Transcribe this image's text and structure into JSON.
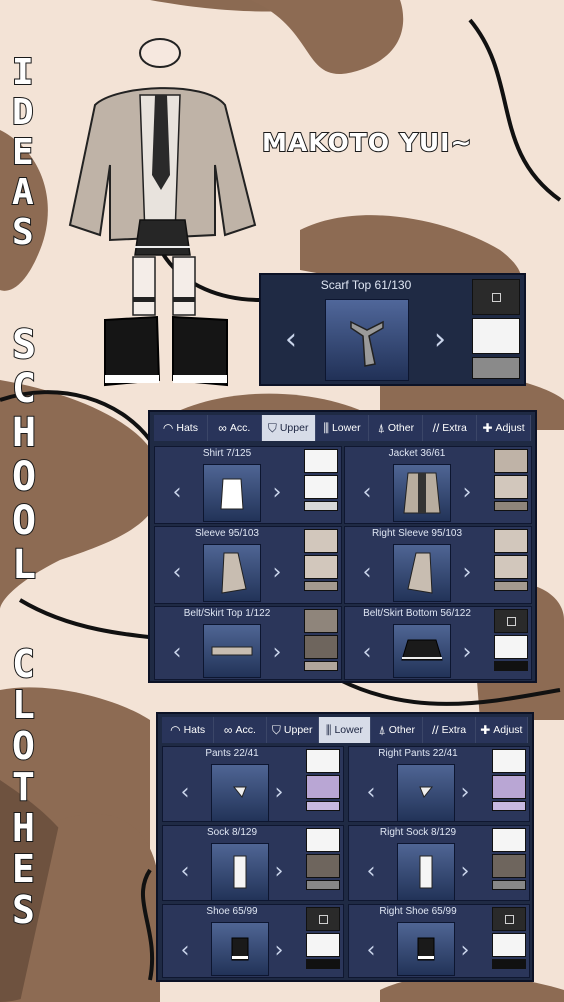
{
  "vertical_text": {
    "ideas": [
      "I",
      "D",
      "E",
      "A",
      "S"
    ],
    "school": [
      "S",
      "C",
      "H",
      "O",
      "O",
      "L"
    ],
    "clothes": [
      "C",
      "L",
      "O",
      "T",
      "H",
      "E",
      "S"
    ]
  },
  "name": "MAKOTO YUI~",
  "scarf": {
    "title": "Scarf Top 61/130"
  },
  "tabs": [
    {
      "icon": "cap-icon",
      "glyph": "◠",
      "label": "Hats"
    },
    {
      "icon": "glasses-icon",
      "glyph": "∞",
      "label": "Acc."
    },
    {
      "icon": "shirt-icon",
      "glyph": "⛉",
      "label": "Upper"
    },
    {
      "icon": "pants-icon",
      "glyph": "⫼",
      "label": "Lower"
    },
    {
      "icon": "bell-icon",
      "glyph": "⍋",
      "label": "Other"
    },
    {
      "icon": "slashes-icon",
      "glyph": "//",
      "label": "Extra"
    },
    {
      "icon": "move-icon",
      "glyph": "✚",
      "label": "Adjust"
    }
  ],
  "panel_upper": {
    "active_tab": "Upper",
    "cells": [
      {
        "title": "Shirt 7/125"
      },
      {
        "title": "Jacket 36/61"
      },
      {
        "title": "Sleeve 95/103"
      },
      {
        "title": "Right Sleeve 95/103"
      },
      {
        "title": "Belt/Skirt Top 1/122"
      },
      {
        "title": "Belt/Skirt Bottom 56/122"
      }
    ]
  },
  "panel_lower": {
    "active_tab": "Lower",
    "cells": [
      {
        "title": "Pants 22/41"
      },
      {
        "title": "Right Pants 22/41"
      },
      {
        "title": "Sock 8/129"
      },
      {
        "title": "Right Sock 8/129"
      },
      {
        "title": "Shoe 65/99"
      },
      {
        "title": "Right Shoe 65/99"
      }
    ]
  },
  "arrows": {
    "prev": "‹",
    "next": "›"
  },
  "colors": {
    "panel": "#1f2a44",
    "brown": "#8b6a52",
    "cream": "#f3e3d6"
  }
}
